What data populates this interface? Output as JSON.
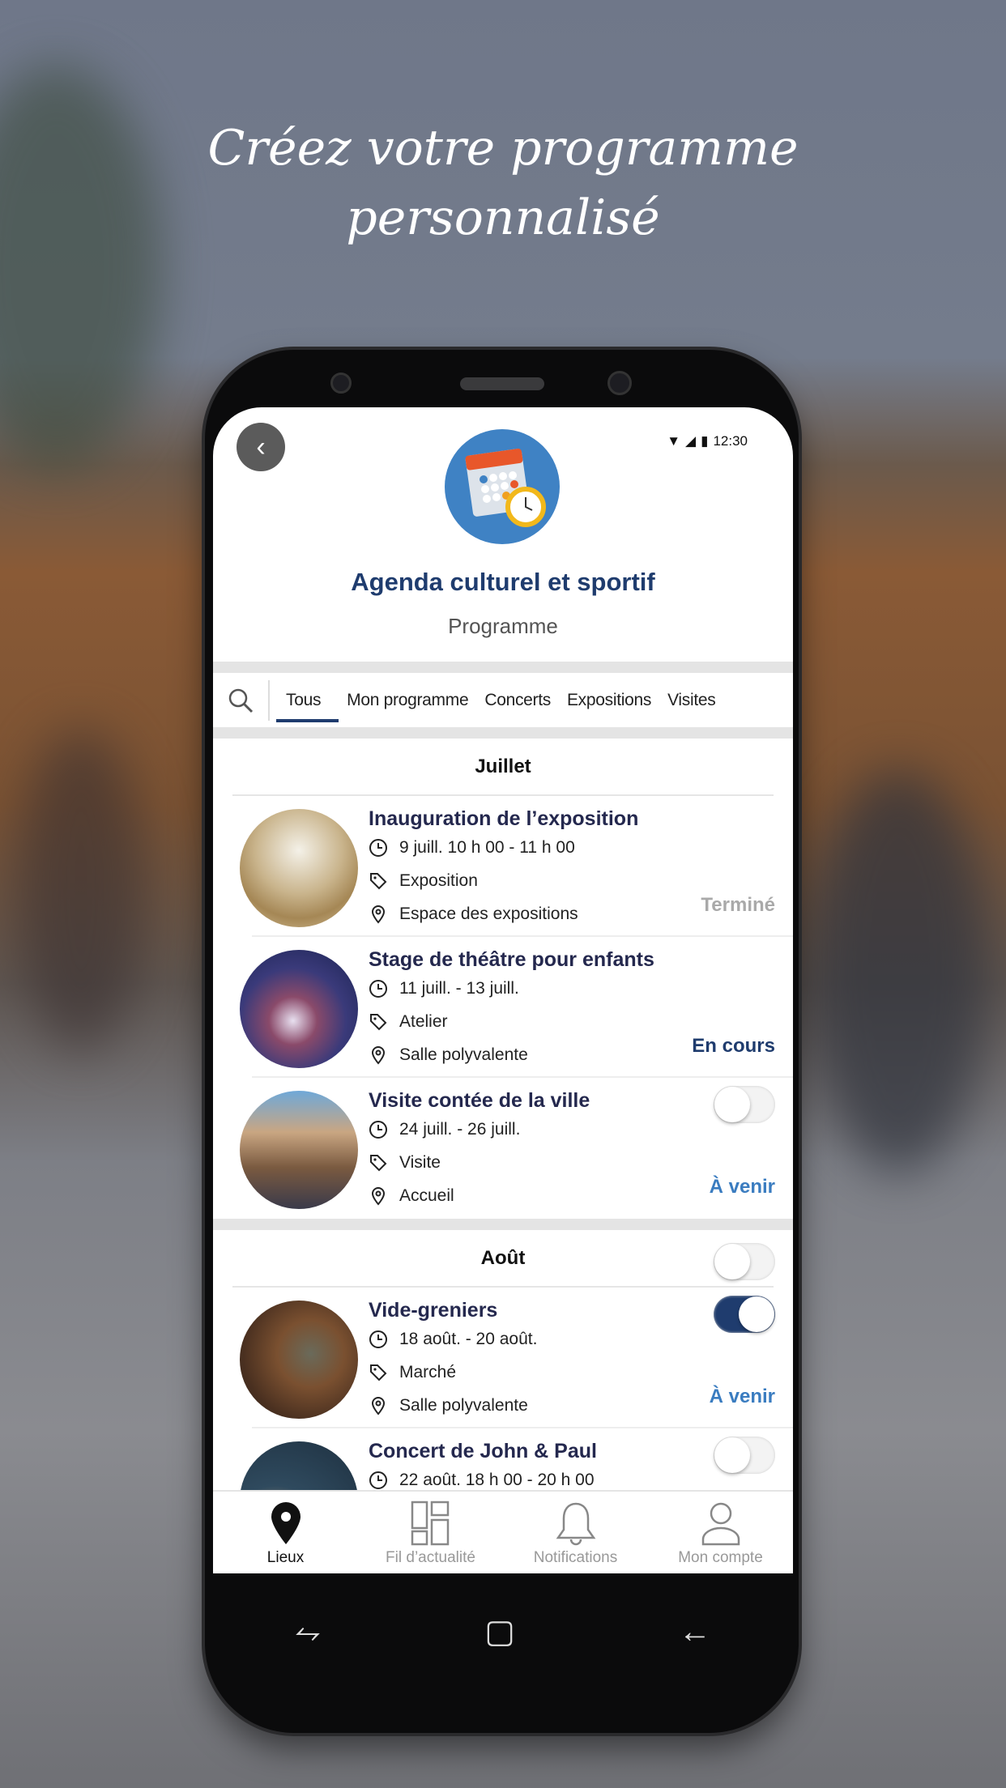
{
  "headline": {
    "line1": "Créez votre programme",
    "line2": "personnalisé"
  },
  "status_bar": {
    "time": "12:30"
  },
  "header": {
    "title": "Agenda culturel et sportif",
    "subtitle": "Programme"
  },
  "tabs": [
    {
      "label": "Tous",
      "active": true
    },
    {
      "label": "Mon programme"
    },
    {
      "label": "Concerts"
    },
    {
      "label": "Expositions"
    },
    {
      "label": "Visites"
    }
  ],
  "months": [
    {
      "label": "Juillet",
      "events": [
        {
          "title": "Inauguration de l’exposition",
          "date": "9 juill. 10 h 00 - 11 h 00",
          "category": "Exposition",
          "place": "Espace des expositions",
          "status": "Terminé"
        },
        {
          "title": "Stage de théâtre pour enfants",
          "date": "11 juill. - 13 juill.",
          "category": "Atelier",
          "place": "Salle polyvalente",
          "status": "En cours"
        },
        {
          "title": "Visite contée de la ville",
          "date": "24 juill. - 26 juill.",
          "category": "Visite",
          "place": "Accueil",
          "status": "À venir",
          "in_program": false
        }
      ]
    },
    {
      "label": "Août",
      "in_program": false,
      "events": [
        {
          "title": "Vide-greniers",
          "date": "18 août. - 20 août.",
          "category": "Marché",
          "place": "Salle polyvalente",
          "status": "À venir",
          "in_program": true
        },
        {
          "title": "Concert de John & Paul",
          "date": "22 août. 18 h 00 - 20 h 00",
          "in_program": false
        }
      ]
    }
  ],
  "status_colors": {
    "Terminé": "#a9a9a9",
    "En cours": "#1f3c6e",
    "À venir": "#3a7cc0"
  },
  "bottom_nav": [
    {
      "label": "Lieux",
      "icon": "map-pin-icon",
      "active": true
    },
    {
      "label": "Fil d’actualité",
      "icon": "grid-icon"
    },
    {
      "label": "Notifications",
      "icon": "bell-icon"
    },
    {
      "label": "Mon compte",
      "icon": "user-icon"
    }
  ]
}
